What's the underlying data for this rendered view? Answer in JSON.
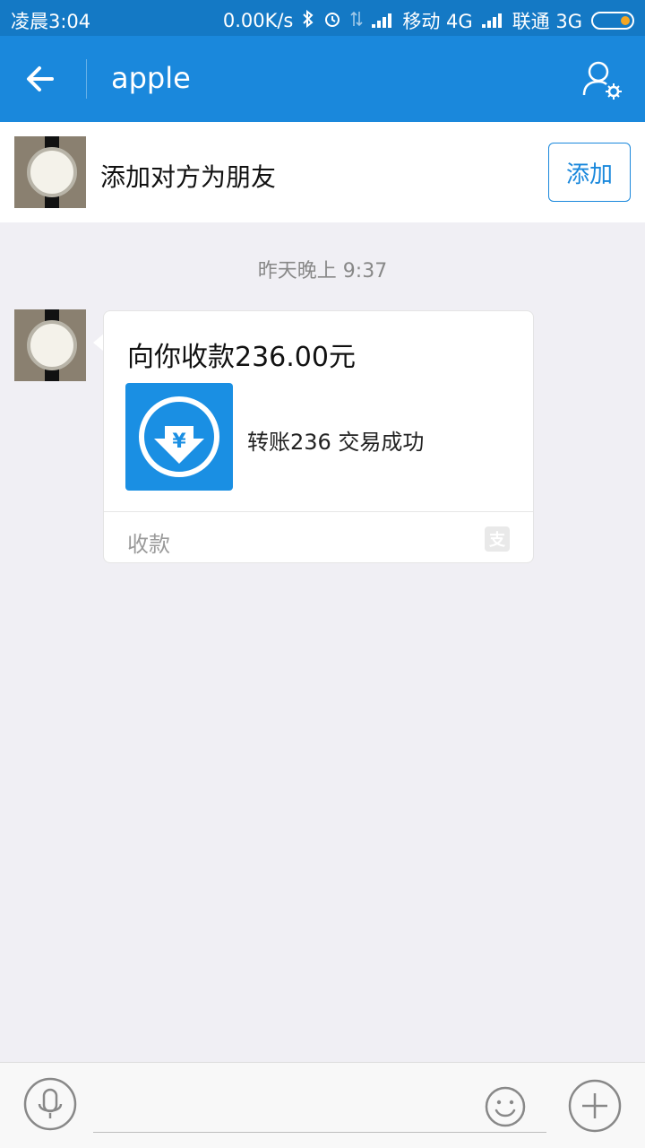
{
  "status_bar": {
    "time": "凌晨3:04",
    "speed": "0.00K/s",
    "carrier1": "移动 4G",
    "carrier2": "联通 3G"
  },
  "header": {
    "title": "apple",
    "back_icon": "arrow-left-icon",
    "profile_icon": "user-settings-icon"
  },
  "add_friend": {
    "text": "添加对方为朋友",
    "button_label": "添加"
  },
  "chat": {
    "timestamp": "昨天晚上 9:37",
    "message": {
      "title": "向你收款236.00元",
      "description": "转账236 交易成功",
      "footer": "收款",
      "brand_mark": "支",
      "icon": "yuan-download-icon"
    }
  },
  "input_bar": {
    "placeholder": "",
    "voice_icon": "microphone-icon",
    "emoji_icon": "smiley-icon",
    "plus_icon": "plus-icon"
  },
  "colors": {
    "brand_blue": "#1a88dc",
    "status_blue": "#1479c5",
    "pay_icon_blue": "#1a8fe3",
    "background": "#f0eff4"
  }
}
